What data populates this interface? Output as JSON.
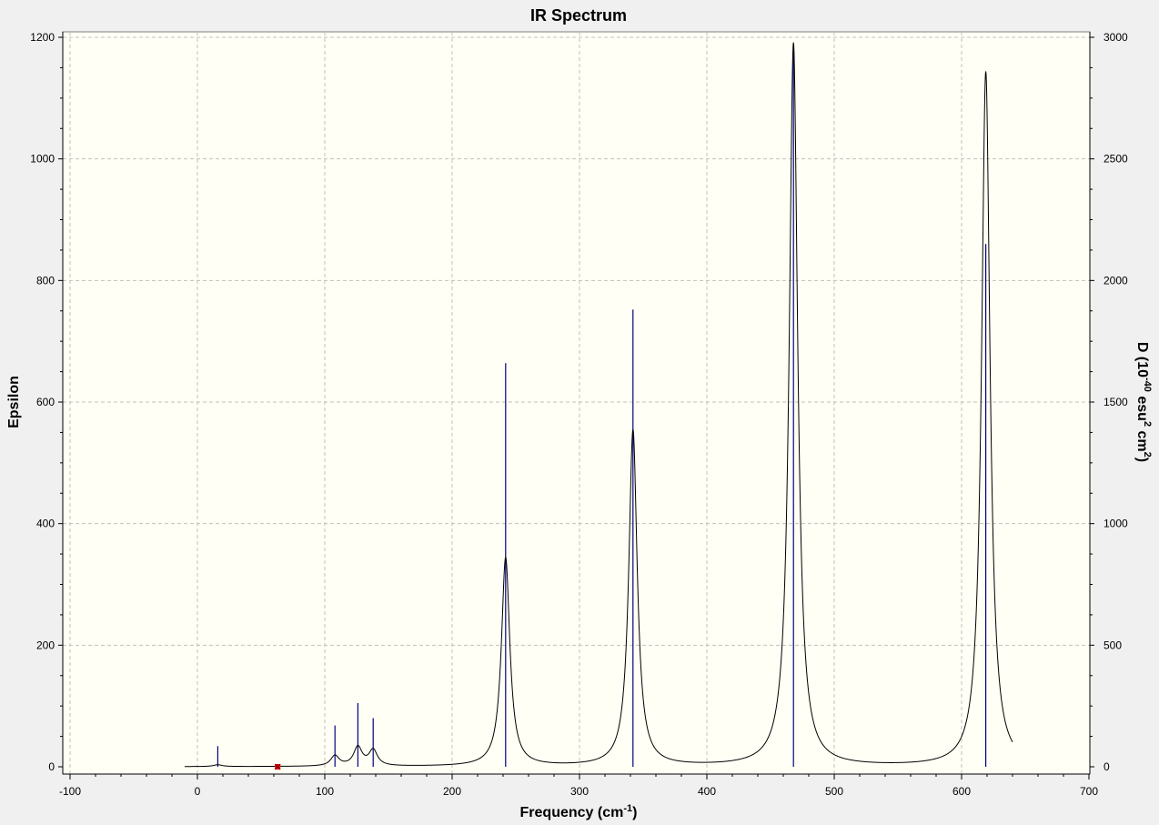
{
  "chart_data": {
    "type": "line",
    "title": "IR Spectrum",
    "xlabel": "Frequency (cm",
    "xlabel_sup": "-1",
    "xlabel_end": ")",
    "ylabel": "Epsilon",
    "y2label_parts": [
      "D (10",
      "-40",
      " esu",
      "2",
      " cm",
      "2",
      ")"
    ],
    "xlim": [
      -100,
      700
    ],
    "ylim": [
      0,
      1200
    ],
    "y2lim": [
      0,
      3000
    ],
    "x_ticks": [
      -100,
      0,
      100,
      200,
      300,
      400,
      500,
      600,
      700
    ],
    "y_ticks": [
      0,
      200,
      400,
      600,
      800,
      1000,
      1200
    ],
    "y2_ticks": [
      0,
      500,
      1000,
      1500,
      2000,
      2500,
      3000
    ],
    "grid": true,
    "background_color": "#fffff5",
    "line_color": "#000000",
    "stick_color": "#000080",
    "marker_color": "#e00000",
    "spectrum_range": [
      -10,
      640
    ],
    "peaks": [
      {
        "frequency": 16,
        "epsilon": 3
      },
      {
        "frequency": 108,
        "epsilon": 17
      },
      {
        "frequency": 126,
        "epsilon": 31
      },
      {
        "frequency": 138,
        "epsilon": 26
      },
      {
        "frequency": 242,
        "epsilon": 343
      },
      {
        "frequency": 342,
        "epsilon": 553
      },
      {
        "frequency": 468,
        "epsilon": 1190
      },
      {
        "frequency": 619,
        "epsilon": 1143
      }
    ],
    "sticks": [
      {
        "frequency": 16,
        "D": 85
      },
      {
        "frequency": 108,
        "D": 170
      },
      {
        "frequency": 126,
        "D": 262
      },
      {
        "frequency": 138,
        "D": 200
      },
      {
        "frequency": 242,
        "D": 1660
      },
      {
        "frequency": 342,
        "D": 1880
      },
      {
        "frequency": 468,
        "D": 2960
      },
      {
        "frequency": 619,
        "D": 2150
      }
    ],
    "marker": {
      "frequency": 63,
      "epsilon": 0
    }
  }
}
